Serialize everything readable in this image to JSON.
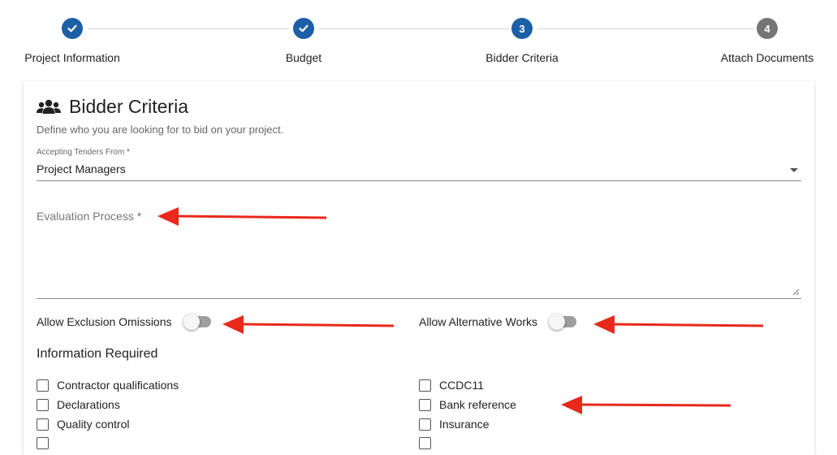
{
  "stepper": {
    "steps": [
      {
        "label": "Project Information",
        "status": "done",
        "icon": "check-icon"
      },
      {
        "label": "Budget",
        "status": "done",
        "icon": "check-icon"
      },
      {
        "label": "Bidder Criteria",
        "status": "active",
        "number": "3"
      },
      {
        "label": "Attach Documents",
        "status": "todo",
        "number": "4"
      }
    ]
  },
  "card": {
    "icon": "users-icon",
    "title": "Bidder Criteria",
    "subtitle": "Define who you are looking for to bid on your project."
  },
  "tenders_field": {
    "label": "Accepting Tenders From *",
    "value": "Project Managers"
  },
  "evaluation_field": {
    "placeholder": "Evaluation Process *",
    "value": ""
  },
  "toggles": {
    "exclusion": {
      "label": "Allow Exclusion Omissions",
      "on": false
    },
    "alternative": {
      "label": "Allow Alternative Works",
      "on": false
    }
  },
  "information": {
    "title": "Information Required",
    "left": [
      {
        "label": "Contractor qualifications",
        "checked": false
      },
      {
        "label": "Declarations",
        "checked": false
      },
      {
        "label": "Quality control",
        "checked": false
      }
    ],
    "right": [
      {
        "label": "CCDC11",
        "checked": false
      },
      {
        "label": "Bank reference",
        "checked": false
      },
      {
        "label": "Insurance",
        "checked": false
      }
    ]
  },
  "colors": {
    "step_done": "#1d5fa6",
    "step_todo": "#757575",
    "annotation_arrow": "#e8291c"
  }
}
